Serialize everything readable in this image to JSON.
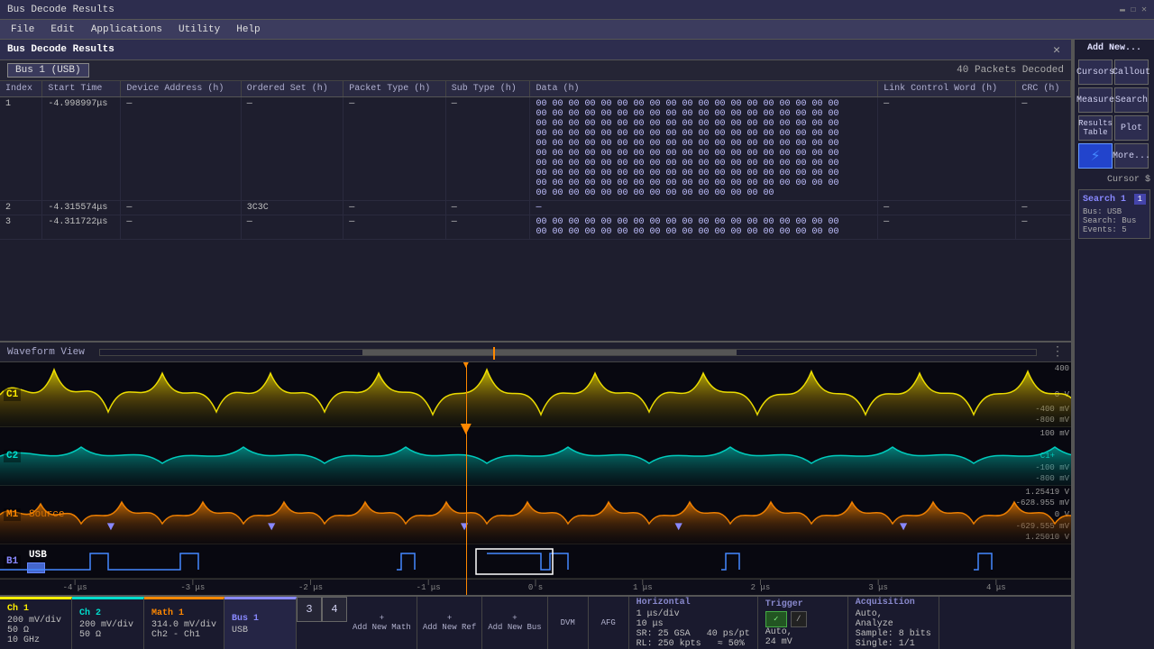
{
  "titlebar": {
    "title": "Bus Decode Results"
  },
  "menubar": {
    "items": [
      "File",
      "Edit",
      "Applications",
      "Utility",
      "Help"
    ]
  },
  "decode_panel": {
    "title": "Bus Decode Results",
    "bus_label": "Bus 1 (USB)",
    "packets_decoded": "40 Packets Decoded",
    "columns": [
      "Index",
      "Start Time",
      "Device Address (h)",
      "Ordered Set (h)",
      "Packet Type (h)",
      "Sub Type (h)",
      "Data (h)",
      "Link Control Word (h)",
      "CRC (h)"
    ],
    "rows": [
      {
        "index": "1",
        "start_time": "-4.998997μs",
        "device_addr": "—",
        "ordered_set": "—",
        "packet_type": "—",
        "sub_type": "—",
        "data": "00 00 00 00 00 00 00 00 00 00 00 00 00 00 00 00 00 00 00\n00 00 00 00 00 00 00 00 00 00 00 00 00 00 00 00 00 00 00\n00 00 00 00 00 00 00 00 00 00 00 00 00 00 00 00 00 00 00\n00 00 00 00 00 00 00 00 00 00 00 00 00 00 00 00 00 00 00\n00 00 00 00 00 00 00 00 00 00 00 00 00 00 00 00 00 00 00\n00 00 00 00 00 00 00 00 00 00 00 00 00 00 00 00 00 00 00\n00 00 00 00 00 00 00 00 00 00 00 00 00 00 00 00 00 00 00\n00 00 00 00 00 00 00 00 00 00 00 00 00 00 00 00 00 00 00\n00 00 00 00 00 00 00 00 00 00 00 00 00 00 00 00 00 00 00\n00 00 00 00 00 00 00 00 00 00 00 00 00 00 00",
        "link_control": "—",
        "crc": "—"
      },
      {
        "index": "2",
        "start_time": "-4.315574μs",
        "device_addr": "—",
        "ordered_set": "3C3C",
        "packet_type": "—",
        "sub_type": "—",
        "data": "—",
        "link_control": "—",
        "crc": "—"
      },
      {
        "index": "3",
        "start_time": "-4.311722μs",
        "device_addr": "—",
        "ordered_set": "—",
        "packet_type": "—",
        "sub_type": "—",
        "data": "00 00 00 00 00 00 00 00 00 00 00 00 00 00 00 00 00 00 00\n00 00 00 00 00 00 00 00 00 00 00 00 00 00 00 00 00 00 00",
        "link_control": "—",
        "crc": "—"
      }
    ]
  },
  "waveform": {
    "title": "Waveform View",
    "channels": [
      {
        "id": "C1",
        "color": "#ffee00",
        "top_val": "400",
        "mid_val": "0 V",
        "bot_val": "-400 mV",
        "bot2_val": "-800 mV"
      },
      {
        "id": "C2",
        "color": "#00ddcc",
        "top_val": "100 mV",
        "c2_right": "C1+",
        "bot_val": "-100 mV",
        "bot2_val": "-800 mV"
      },
      {
        "id": "M1",
        "label": "Source",
        "color": "#ff8800",
        "top_val": "1.25419 V",
        "bot_val": "-628.955 mV",
        "mid_val": "0 V",
        "bot2_val": "-629.555 mV",
        "top2_val": "1.25010 V"
      },
      {
        "id": "B1",
        "label": "USB",
        "color": "#4488ff"
      }
    ],
    "time_labels": [
      "-4 μs",
      "-3 μs",
      "-2 μs",
      "-1 μs",
      "0's",
      "1 μs",
      "2 μs",
      "3 μs",
      "4 μs"
    ]
  },
  "bottom_bar": {
    "channels": [
      {
        "label": "Ch 1",
        "color": "#ffee00",
        "val1": "200 mV/div",
        "val2": "50 Ω",
        "val3": "10 GHz"
      },
      {
        "label": "Ch 2",
        "color": "#00ddcc",
        "val1": "200 mV/div",
        "val2": "50 Ω"
      },
      {
        "label": "Math 1",
        "color": "#ff8800",
        "val1": "314.0 mV/div",
        "val2": "Ch2 - Ch1"
      },
      {
        "label": "Bus 1",
        "color": "#8888ff",
        "val1": "USB"
      }
    ],
    "buttons": [
      "3",
      "4"
    ],
    "add_buttons": [
      "Add New Math",
      "Add New Ref",
      "Add New Bus"
    ],
    "dvm_label": "DVM",
    "afg_label": "AFG",
    "horizontal": {
      "title": "Horizontal",
      "val1": "1 μs/div",
      "val2": "10 μs",
      "sr_label": "SR: 25 GSA",
      "sr_val2": "40 ps/pt",
      "rl_label": "RL: 250 kpts",
      "rl_val2": "≈ 50%"
    },
    "trigger": {
      "title": "Trigger",
      "val1": "Auto,",
      "val2": "24 mV"
    },
    "acquisition": {
      "title": "Acquisition",
      "val1": "Auto,",
      "val2": "Analyze",
      "val3": "Sample: 8 bits",
      "val4": "Single: 1/1"
    }
  },
  "sidebar": {
    "add_new_label": "Add New...",
    "cursors_label": "Cursors",
    "callout_label": "Callout",
    "measure_label": "Measure",
    "search_label": "Search",
    "results_table_label": "Results Table",
    "plot_label": "Plot",
    "more_label": "More...",
    "cursor_dollar": "Cursor $",
    "search_section": {
      "title": "Search 1",
      "bus_label": "Bus: USB",
      "search_label": "Search: Bus",
      "events_label": "Events: 5"
    }
  }
}
